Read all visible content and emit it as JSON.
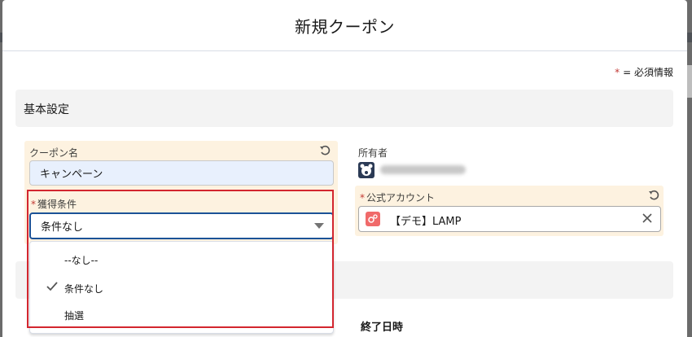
{
  "modal": {
    "title": "新規クーポン",
    "required_note": "= 必須情報",
    "required_mark": "*"
  },
  "sections": {
    "basic": "基本設定"
  },
  "fields": {
    "coupon_name": {
      "label": "クーポン名",
      "value": "キャンペーン"
    },
    "acquisition": {
      "label": "獲得条件",
      "value": "条件なし",
      "options": [
        {
          "label": "--なし--",
          "selected": false
        },
        {
          "label": "条件なし",
          "selected": true
        },
        {
          "label": "抽選",
          "selected": false
        }
      ]
    },
    "owner": {
      "label": "所有者"
    },
    "official_account": {
      "label": "公式アカウント",
      "value": "【デモ】LAMP"
    },
    "end_datetime": {
      "label": "終了日時"
    }
  },
  "colors": {
    "required": "#c23934",
    "focus": "#1b5297",
    "highlight": "#d3262f",
    "field_tint": "#fdf2e0"
  }
}
